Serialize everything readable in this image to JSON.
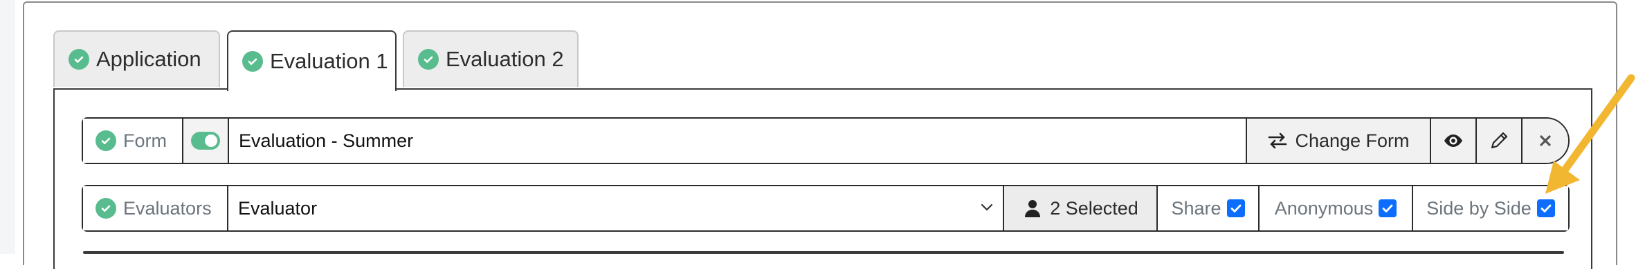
{
  "tabs": [
    {
      "label": "Application",
      "active": false
    },
    {
      "label": "Evaluation 1",
      "active": true
    },
    {
      "label": "Evaluation 2",
      "active": false
    }
  ],
  "form_row": {
    "label": "Form",
    "value": "Evaluation - Summer",
    "change_button": "Change Form",
    "icons": [
      "check-circle-icon",
      "toggle-switch",
      "swap-arrows-icon",
      "eye-icon",
      "pencil-icon",
      "close-icon"
    ]
  },
  "evaluators_row": {
    "label": "Evaluators",
    "select_value": "Evaluator",
    "selected_button": "2 Selected",
    "share_label": "Share",
    "anonymous_label": "Anonymous",
    "side_by_side_label": "Side by Side",
    "share_checked": true,
    "anonymous_checked": true,
    "side_by_side_checked": true,
    "icons": [
      "check-circle-icon",
      "chevron-down-icon",
      "user-icon",
      "checkbox-icon"
    ]
  },
  "colors": {
    "success": "#58bc8e",
    "checkbox": "#0d6efd",
    "annotation_arrow": "#f2b731"
  }
}
